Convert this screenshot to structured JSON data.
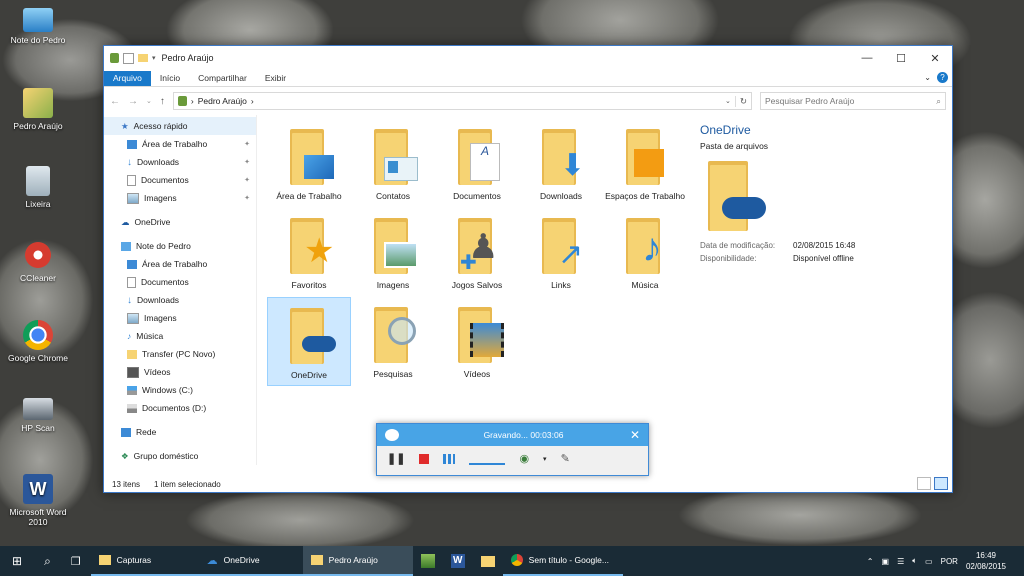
{
  "desktop": {
    "icons": [
      {
        "label": "Note do Pedro"
      },
      {
        "label": "Pedro Araújo"
      },
      {
        "label": "Lixeira"
      },
      {
        "label": "CCleaner"
      },
      {
        "label": "Google Chrome"
      },
      {
        "label": "HP Scan"
      },
      {
        "label": "Microsoft Word 2010"
      }
    ]
  },
  "window": {
    "title": "Pedro Araújo",
    "controls": {
      "minimize": "—",
      "maximize": "☐",
      "close": "✕"
    },
    "ribbon_tabs": [
      "Arquivo",
      "Início",
      "Compartilhar",
      "Exibir"
    ],
    "address": {
      "path": "Pedro Araújo",
      "sep": "›"
    },
    "search_placeholder": "Pesquisar Pedro Araújo",
    "nav_pane": {
      "quick_access": "Acesso rápido",
      "quick_items": [
        "Área de Trabalho",
        "Downloads",
        "Documentos",
        "Imagens"
      ],
      "onedrive": "OneDrive",
      "this_pc": "Note do Pedro",
      "pc_items": [
        "Área de Trabalho",
        "Documentos",
        "Downloads",
        "Imagens",
        "Música",
        "Transfer (PC Novo)",
        "Vídeos",
        "Windows (C:)",
        "Documentos (D:)"
      ],
      "network": "Rede",
      "homegroup": "Grupo doméstico"
    },
    "items": [
      "Área de Trabalho",
      "Contatos",
      "Documentos",
      "Downloads",
      "Espaços de Trabalho",
      "Favoritos",
      "Imagens",
      "Jogos Salvos",
      "Links",
      "Música",
      "OneDrive",
      "Pesquisas",
      "Vídeos"
    ],
    "details": {
      "name": "OneDrive",
      "type": "Pasta de arquivos",
      "modified_label": "Data de modificação:",
      "modified_value": "02/08/2015 16:48",
      "availability_label": "Disponibilidade:",
      "availability_value": "Disponível offline"
    },
    "status": {
      "count": "13 itens",
      "selected": "1 item selecionado"
    }
  },
  "recorder": {
    "status": "Gravando... 00:03:06"
  },
  "taskbar": {
    "items": [
      "Capturas",
      "OneDrive",
      "Pedro Araújo",
      "Sem título - Google..."
    ],
    "language": "POR",
    "time": "16:49",
    "date": "02/08/2015"
  },
  "colors": {
    "accent": "#1979ca",
    "folder": "#f6d373",
    "taskbar": "#1a2b36"
  }
}
